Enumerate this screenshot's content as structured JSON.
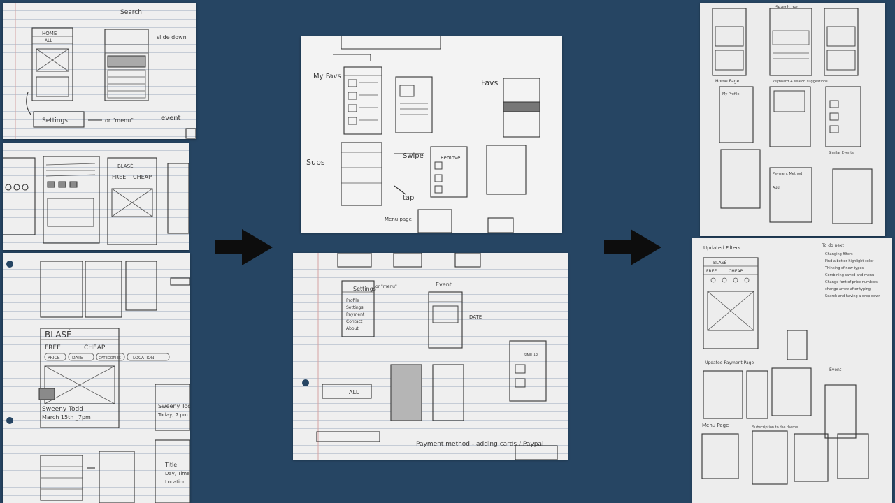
{
  "photos": {
    "p1": {
      "search_note": "Search",
      "slide_note": "slide down",
      "home_label": "HOME",
      "all_label": "ALL",
      "settings_label": "Settings",
      "menu_note": "or \"menu\"",
      "event_label": "event"
    },
    "p2": {
      "free_label": "FREE",
      "cheap_label": "CHEAP",
      "blase_label": "BLASÉ"
    },
    "p3": {
      "blase_title": "BLASÉ",
      "free_label": "FREE",
      "cheap_label": "CHEAP",
      "price_chip": "PRICE",
      "date_chip": "DATE",
      "categories_chip": "CATEGORIES",
      "location_chip": "LOCATION",
      "event_title": "Sweeny Todd",
      "event_date": "March 15th _7pm",
      "event_title2": "Sweeny Todd",
      "event_date2": "Today, 7 pm",
      "note_title": "Title",
      "note_day": "Day, Time",
      "note_location": "Location"
    },
    "p4": {
      "favs_note": "My Favs",
      "favs_label": "Favs",
      "subs_note": "Subs",
      "swipe_note": "Swipe",
      "tap_note": "tap",
      "remove_label": "Remove",
      "menu_note": "Menu page"
    },
    "p5": {
      "settings_label": "Settings",
      "menu_note": "or \"menu\"",
      "event_label": "Event",
      "profile_item": "Profile",
      "settings_item": "Settings",
      "payment_item": "Payment",
      "contact_item": "Contact",
      "about_item": "About",
      "date_note": "DATE",
      "all_label": "ALL",
      "payment_note": "Payment method - adding cards / Paypal",
      "similar_label": "SIMILAR"
    },
    "p6": {
      "search_bar_note": "Search bar",
      "home_page": "Home Page",
      "keyboard_note": "keyboard + search suggestions",
      "payment_method": "Payment Method",
      "add_label": "Add",
      "similar_events": "Similar Events",
      "my_profile": "My Profile"
    },
    "p7": {
      "updated_filters": "Updated Filters",
      "blase_label": "BLASÉ",
      "free_label": "FREE",
      "cheap_label": "CHEAP",
      "to_do_title": "To do next",
      "todo_items": [
        "Changing filters",
        "Find a better highlight color",
        "Thinking of new types",
        "Combining saved and menu",
        "Change font of price numbers",
        "change arrow after typing",
        "Search and having a drop down"
      ],
      "payment_page": "Updated Payment Page",
      "menu_page": "Menu Page",
      "subscription_note": "Subscription to the theme",
      "event_label": "Event"
    }
  }
}
